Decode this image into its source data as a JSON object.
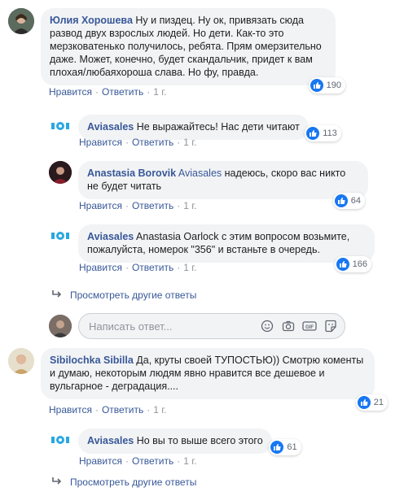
{
  "accent": "#385898",
  "like_color": "#1877f2",
  "comments": [
    {
      "author": "Юлия Хорошева",
      "mention": "",
      "text": "Ну и пиздец. Ну ок, привязать сюда развод двух взрослых людей. Но дети. Как-то это мерзковатенько получилось, ребята. Прям омерзительно даже. Может, конечно, будет скандальчик, придет к вам плохая/любаяхороша слава. Но фу, правда.",
      "likes": "190",
      "actions": {
        "like": "Нравится",
        "reply": "Ответить",
        "time": "1 г."
      }
    },
    {
      "author": "Aviasales",
      "mention": "",
      "text": "Не выражайтесь! Нас дети читают",
      "likes": "113",
      "actions": {
        "like": "Нравится",
        "reply": "Ответить",
        "time": "1 г."
      }
    },
    {
      "author": "Anastasia Borovik",
      "mention": "Aviasales",
      "text": "надеюсь, скоро вас никто не будет читать",
      "likes": "64",
      "actions": {
        "like": "Нравится",
        "reply": "Ответить",
        "time": "1 г."
      }
    },
    {
      "author": "Aviasales",
      "mention": "",
      "text": "Anastasia Oarlock с этим вопросом возьмите, пожалуйста, номерок \"356\" и встаньте в очередь.",
      "likes": "166",
      "actions": {
        "like": "Нравится",
        "reply": "Ответить",
        "time": "1 г."
      }
    },
    {
      "author": "Sibilochka Sibilla",
      "mention": "",
      "text": "Да, круты своей ТУПОСТЬЮ)) Смотрю коменты и думаю, некоторым людям явно нравится все дешевое и вульгарное - деградация....",
      "likes": "21",
      "actions": {
        "like": "Нравится",
        "reply": "Ответить",
        "time": "1 г."
      }
    },
    {
      "author": "Aviasales",
      "mention": "",
      "text": "Но вы то выше всего этого",
      "likes": "61",
      "actions": {
        "like": "Нравится",
        "reply": "Ответить",
        "time": "1 г."
      }
    }
  ],
  "more_replies": [
    "Просмотреть другие ответы",
    "Просмотреть другие ответы"
  ],
  "reply_placeholder": "Написать ответ...",
  "reply_icons": [
    "emoji-icon",
    "camera-icon",
    "gif-icon",
    "sticker-icon"
  ]
}
